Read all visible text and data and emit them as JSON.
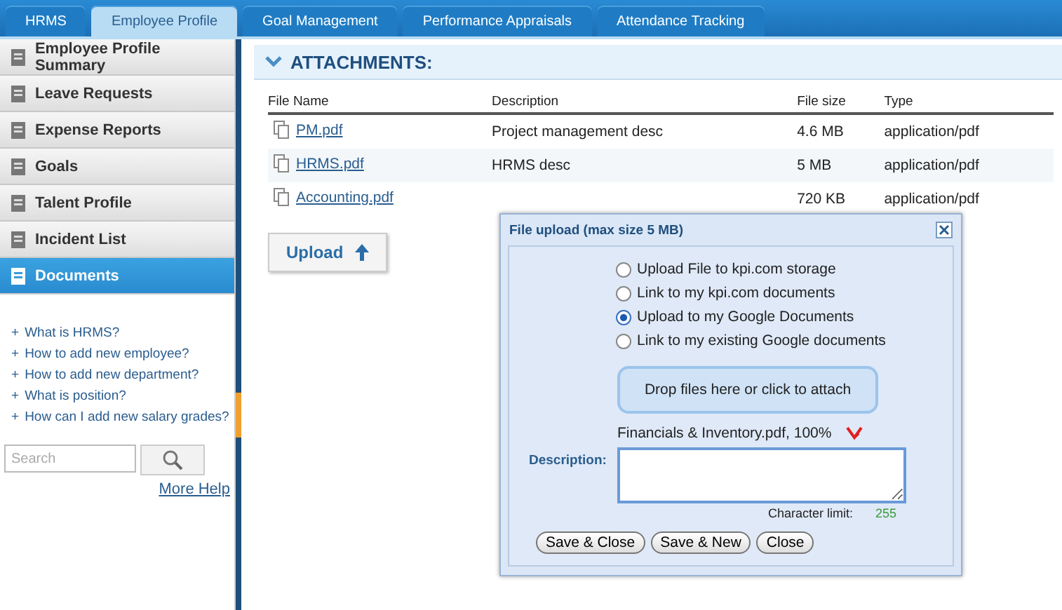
{
  "tabs": [
    {
      "label": "HRMS",
      "selected": false
    },
    {
      "label": "Employee Profile",
      "selected": true
    },
    {
      "label": "Goal Management",
      "selected": false
    },
    {
      "label": "Performance Appraisals",
      "selected": false
    },
    {
      "label": "Attendance Tracking",
      "selected": false
    }
  ],
  "sidebar": {
    "items": [
      {
        "label": "Employee Profile Summary",
        "selected": false
      },
      {
        "label": "Leave Requests",
        "selected": false
      },
      {
        "label": "Expense Reports",
        "selected": false
      },
      {
        "label": "Goals",
        "selected": false
      },
      {
        "label": "Talent Profile",
        "selected": false
      },
      {
        "label": "Incident List",
        "selected": false
      },
      {
        "label": "Documents",
        "selected": true
      }
    ],
    "help_links": [
      {
        "bullet": "+",
        "text": "What is HRMS?"
      },
      {
        "bullet": "+",
        "text": "How to add new employee?"
      },
      {
        "bullet": "+",
        "text": "How to add new department?"
      },
      {
        "bullet": "+",
        "text": "What is position?"
      },
      {
        "bullet": "+",
        "text": "How can I add new salary grades?"
      }
    ],
    "search": {
      "placeholder": "Search"
    },
    "more_help": "More Help"
  },
  "section": {
    "title": "ATTACHMENTS:",
    "expanded": true
  },
  "table": {
    "columns": [
      "File Name",
      "Description",
      "File size",
      "Type"
    ],
    "rows": [
      {
        "file": "PM.pdf",
        "description": "Project management desc",
        "size": "4.6 MB",
        "type": "application/pdf"
      },
      {
        "file": "HRMS.pdf",
        "description": "HRMS desc",
        "size": "5 MB",
        "type": "application/pdf"
      },
      {
        "file": "Accounting.pdf",
        "size": "720 KB",
        "type": "application/pdf"
      }
    ]
  },
  "upload_button": "Upload",
  "dialog": {
    "title": "File upload (max size 5 MB)",
    "options": [
      {
        "label": "Upload File to kpi.com storage",
        "selected": false
      },
      {
        "label": "Link to my kpi.com documents",
        "selected": false
      },
      {
        "label": "Upload to my Google Documents",
        "selected": true
      },
      {
        "label": "Link to my existing Google documents",
        "selected": false
      }
    ],
    "drop_zone": "Drop files here or click to attach",
    "uploaded_file": "Financials & Inventory.pdf, 100%",
    "description_label": "Description:",
    "char_limit_label": "Character limit:",
    "char_limit": "255",
    "buttons": [
      "Save & Close",
      "Save & New",
      "Close"
    ]
  }
}
